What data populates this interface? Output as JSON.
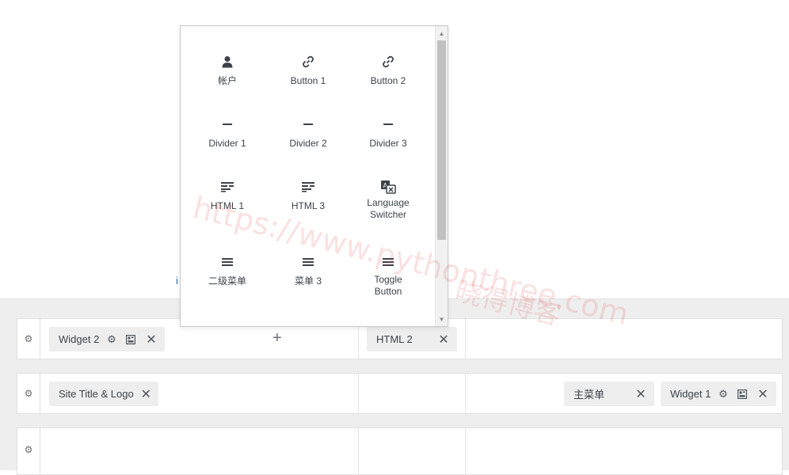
{
  "stray_text": "i",
  "popup": {
    "items": [
      {
        "label": "帐户",
        "icon": "user-icon"
      },
      {
        "label": "Button 1",
        "icon": "link-icon"
      },
      {
        "label": "Button 2",
        "icon": "link-icon"
      },
      {
        "label": "Divider 1",
        "icon": "minus-icon"
      },
      {
        "label": "Divider 2",
        "icon": "minus-icon"
      },
      {
        "label": "Divider 3",
        "icon": "minus-icon"
      },
      {
        "label": "HTML 1",
        "icon": "text-align-icon"
      },
      {
        "label": "HTML 3",
        "icon": "text-align-icon"
      },
      {
        "label": "Language\nSwitcher",
        "icon": "translate-icon"
      },
      {
        "label": "二级菜单",
        "icon": "menu-icon"
      },
      {
        "label": "菜单 3",
        "icon": "menu-icon"
      },
      {
        "label": "Toggle\nButton",
        "icon": "menu-icon"
      }
    ]
  },
  "rows": [
    {
      "chips": [
        {
          "label": "Widget 2",
          "settings": true,
          "layout": true
        },
        {
          "label": "HTML 2",
          "settings": false,
          "layout": false
        }
      ],
      "add_symbol": "+"
    },
    {
      "chips": [
        {
          "label": "Site Title & Logo",
          "settings": false,
          "layout": false
        },
        {
          "label": "主菜单",
          "settings": false,
          "layout": false
        },
        {
          "label": "Widget 1",
          "settings": true,
          "layout": true
        }
      ]
    },
    {
      "chips": []
    }
  ],
  "watermark": {
    "url": "https://www.pythonthree.com",
    "text": "晓得博客"
  },
  "colors": {
    "chip_bg": "#eeeeee",
    "builder_bg": "#eeeeee",
    "link": "#2271b1"
  }
}
